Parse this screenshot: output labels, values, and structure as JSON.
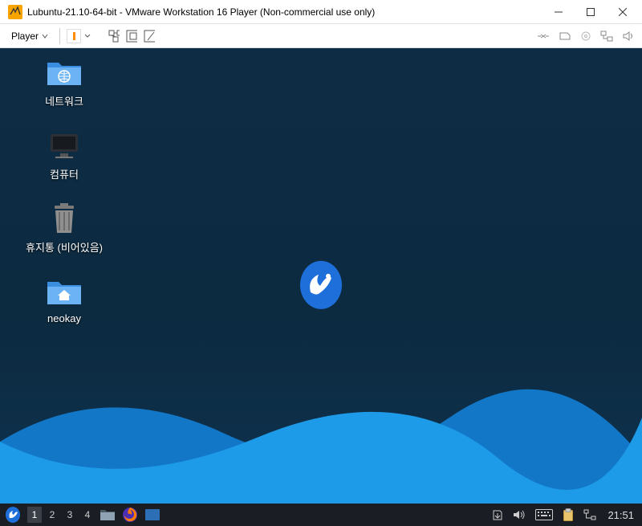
{
  "titlebar": {
    "title": "Lubuntu-21.10-64-bit - VMware Workstation 16 Player (Non-commercial use only)"
  },
  "toolbar": {
    "player_label": "Player"
  },
  "desktop": {
    "icons": [
      {
        "label": "네트워크"
      },
      {
        "label": "컴퓨터"
      },
      {
        "label": "휴지통 (비어있음)"
      },
      {
        "label": "neokay"
      }
    ]
  },
  "taskbar": {
    "workspaces": [
      "1",
      "2",
      "3",
      "4"
    ],
    "clock": "21:51"
  }
}
